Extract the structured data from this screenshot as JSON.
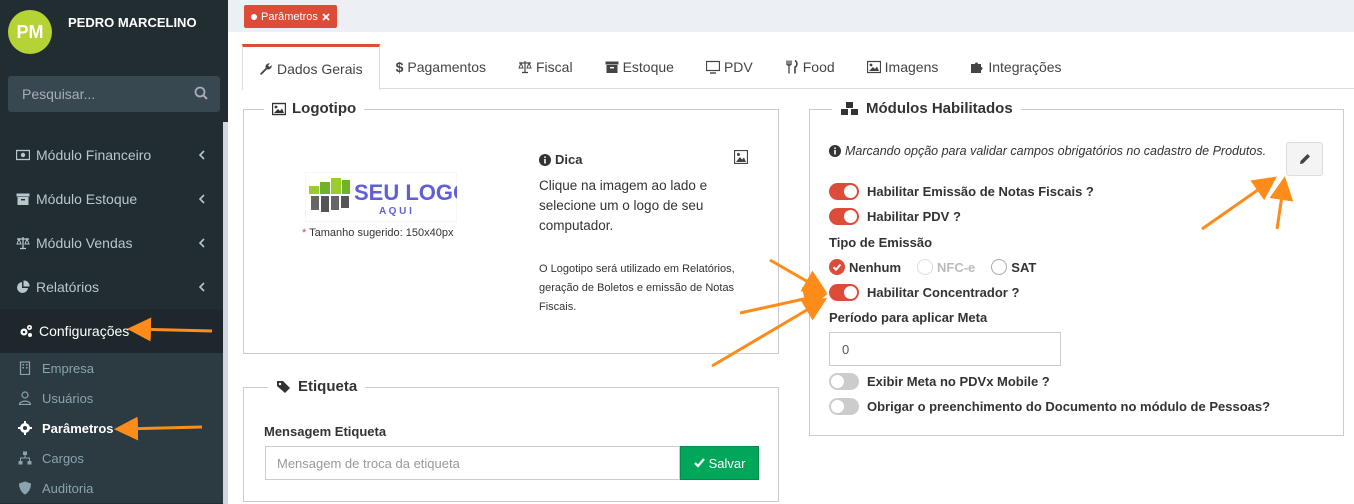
{
  "user": {
    "initials": "PM",
    "name": "PEDRO MARCELINO"
  },
  "search": {
    "placeholder": "Pesquisar..."
  },
  "menu": {
    "items": [
      {
        "label": "Módulo Financeiro"
      },
      {
        "label": "Módulo Estoque"
      },
      {
        "label": "Módulo Vendas"
      },
      {
        "label": "Relatórios"
      },
      {
        "label": "Configurações"
      }
    ],
    "submenu": [
      {
        "label": "Empresa"
      },
      {
        "label": "Usuários"
      },
      {
        "label": "Parâmetros"
      },
      {
        "label": "Cargos"
      },
      {
        "label": "Auditoria"
      }
    ]
  },
  "page_tag": {
    "label": "Parâmetros"
  },
  "tabs": [
    {
      "label": "Dados Gerais"
    },
    {
      "label": "Pagamentos"
    },
    {
      "label": "Fiscal"
    },
    {
      "label": "Estoque"
    },
    {
      "label": "PDV"
    },
    {
      "label": "Food"
    },
    {
      "label": "Imagens"
    },
    {
      "label": "Integrações"
    }
  ],
  "logotipo": {
    "title": "Logotipo",
    "logo_text_1": "SEU LOGO",
    "logo_text_2": "A Q U I",
    "hint_star": "*",
    "hint": " Tamanho sugerido: 150x40px",
    "dica_title": "Dica",
    "dica_text": "Clique na imagem ao lado e selecione um o logo de seu computador.",
    "dica_small": "O Logotipo será utilizado em Relatórios, geração de Boletos e emissão de Notas Fiscais."
  },
  "etiqueta": {
    "title": "Etiqueta",
    "label": "Mensagem Etiqueta",
    "placeholder": "Mensagem de troca da etiqueta",
    "save_label": "Salvar"
  },
  "modulos": {
    "title": "Módulos Habilitados",
    "info": "Marcando opção para validar campos obrigatórios no cadastro de Produtos.",
    "emissao_notas": {
      "label": "Habilitar Emissão de Notas Fiscais ?",
      "on": true
    },
    "pdv": {
      "label": "Habilitar PDV ?",
      "on": true
    },
    "tipo_emissao_label": "Tipo de Emissão",
    "tipo_options": [
      {
        "label": "Nenhum",
        "checked": true
      },
      {
        "label": "NFC-e",
        "disabled": true
      },
      {
        "label": "SAT"
      }
    ],
    "concentrador": {
      "label": "Habilitar Concentrador ?",
      "on": true
    },
    "periodo_label": "Período para aplicar Meta",
    "periodo_value": "0",
    "exibir_meta": {
      "label": "Exibir Meta no PDVx Mobile ?",
      "on": false
    },
    "obrigar_doc": {
      "label": "Obrigar o preenchimento do Documento no módulo de Pessoas?",
      "on": false
    }
  },
  "colors": {
    "sidebar_bg": "#222d32",
    "accent_red": "#dd4b39",
    "success_green": "#00a65a",
    "arrow_orange": "#ff8c1a",
    "avatar_green": "#b5d334"
  }
}
